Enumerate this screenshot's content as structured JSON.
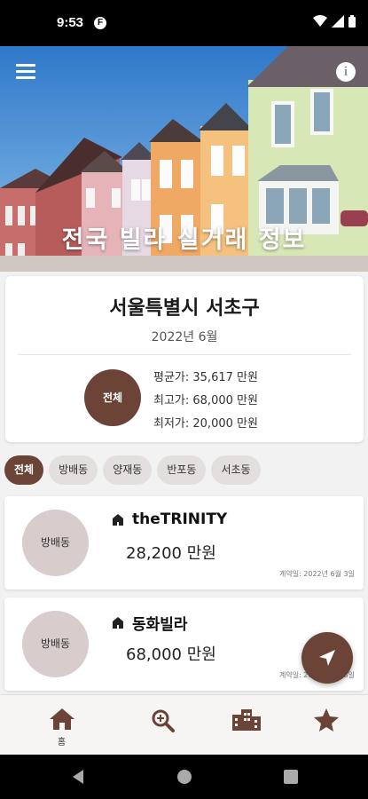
{
  "status_bar": {
    "time": "9:53",
    "app_icon_letter": "F"
  },
  "hero": {
    "title": "전국 빌라 실거래 정보"
  },
  "summary": {
    "region": "서울특별시 서초구",
    "period": "2022년 6월",
    "badge": "전체",
    "avg": "평균가: 35,617 만원",
    "max": "최고가: 68,000 만원",
    "min": "최저가: 20,000 만원"
  },
  "chips": [
    "전체",
    "방배동",
    "양재동",
    "반포동",
    "서초동"
  ],
  "listings": [
    {
      "dong": "방배동",
      "name": "theTRINITY",
      "price": "28,200 만원",
      "date": "계약일: 2022년 6월 3일"
    },
    {
      "dong": "방배동",
      "name": "동화빌라",
      "price": "68,000 만원",
      "date": "계약일: 2022년 6월 3일"
    }
  ],
  "bottom_nav": {
    "home_label": "홈"
  },
  "colors": {
    "accent": "#6b4437",
    "chip": "#e2dfde",
    "dong_circle": "#d8cccc"
  }
}
